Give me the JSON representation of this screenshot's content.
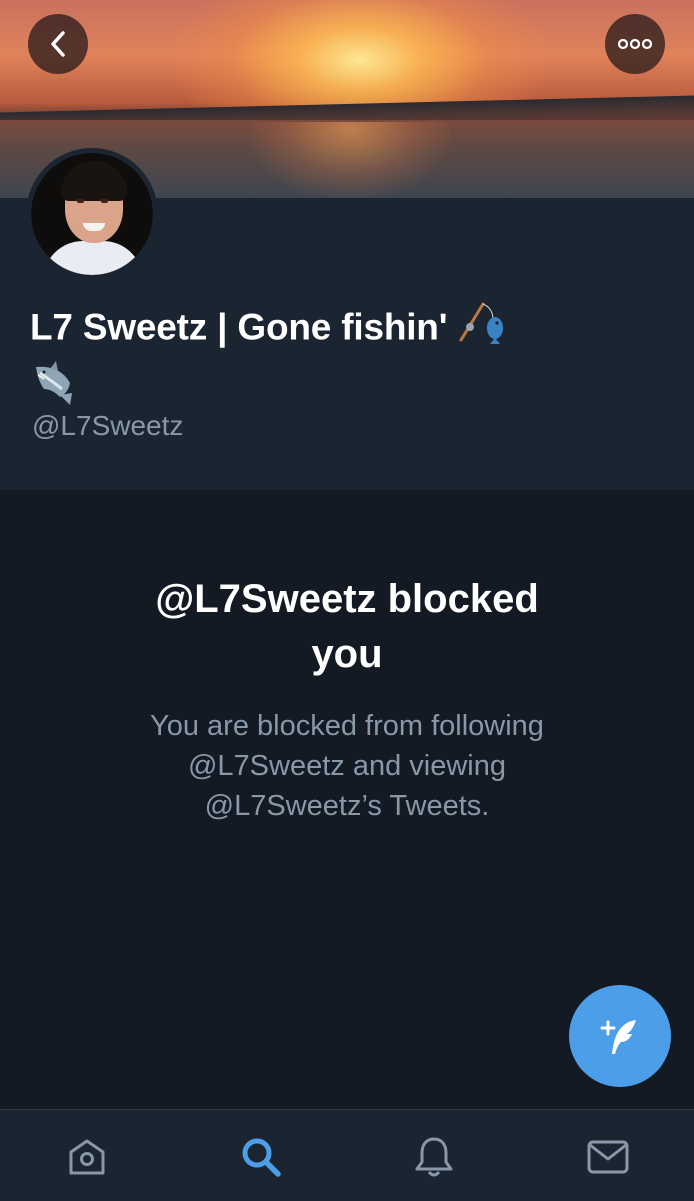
{
  "header": {
    "back_icon": "chevron-left-icon",
    "more_icon": "ellipsis-icon"
  },
  "profile": {
    "display_name": "L7 Sweetz | Gone fishin'",
    "name_emojis": [
      "fishing-pole-emoji",
      "shark-emoji"
    ],
    "handle": "@L7Sweetz"
  },
  "blocked": {
    "title_line1": "@L7Sweetz blocked",
    "title_line2": "you",
    "desc_line1": "You are blocked from following",
    "desc_line2": "@L7Sweetz and viewing",
    "desc_line3": "@L7Sweetz’s Tweets."
  },
  "compose": {
    "icon": "compose-tweet-icon"
  },
  "tabbar": {
    "items": [
      {
        "name": "home",
        "icon": "home-icon",
        "active": false
      },
      {
        "name": "search",
        "icon": "search-icon",
        "active": true
      },
      {
        "name": "notifications",
        "icon": "bell-icon",
        "active": false
      },
      {
        "name": "messages",
        "icon": "mail-icon",
        "active": false
      }
    ]
  },
  "colors": {
    "accent": "#4c9ee9",
    "background": "#141a23",
    "profile_background": "#1b2532",
    "muted_text": "#8898a8"
  }
}
